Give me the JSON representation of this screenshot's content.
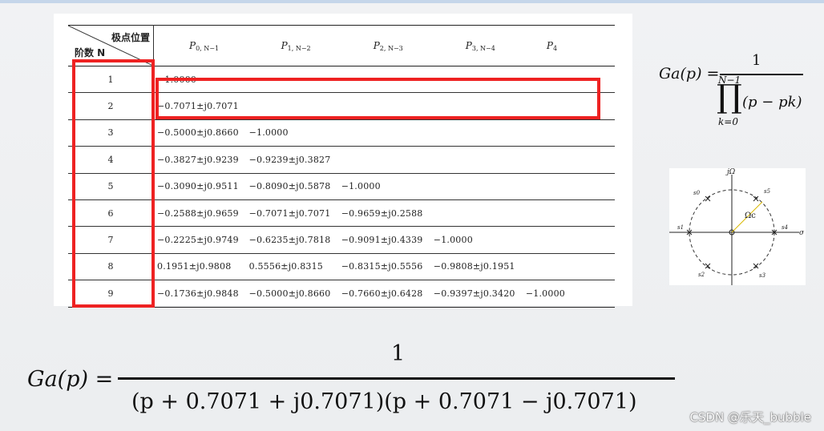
{
  "table": {
    "header_top": "极点位置",
    "header_bottom": "阶数 N",
    "columns": [
      "P0, N−1",
      "P1, N−2",
      "P2, N−3",
      "P3, N−4",
      "P4"
    ],
    "col_main": [
      "P",
      "P",
      "P",
      "P",
      "P"
    ],
    "col_sub": [
      "0, N−1",
      "1, N−2",
      "2, N−3",
      "3, N−4",
      "4"
    ],
    "rows": [
      {
        "n": "1",
        "cells": [
          "−1.0000",
          "",
          "",
          "",
          ""
        ]
      },
      {
        "n": "2",
        "cells": [
          "−0.7071±j0.7071",
          "",
          "",
          "",
          ""
        ]
      },
      {
        "n": "3",
        "cells": [
          "−0.5000±j0.8660",
          "−1.0000",
          "",
          "",
          ""
        ]
      },
      {
        "n": "4",
        "cells": [
          "−0.3827±j0.9239",
          "−0.9239±j0.3827",
          "",
          "",
          ""
        ]
      },
      {
        "n": "5",
        "cells": [
          "−0.3090±j0.9511",
          "−0.8090±j0.5878",
          "−1.0000",
          "",
          ""
        ]
      },
      {
        "n": "6",
        "cells": [
          "−0.2588±j0.9659",
          "−0.7071±j0.7071",
          "−0.9659±j0.2588",
          "",
          ""
        ]
      },
      {
        "n": "7",
        "cells": [
          "−0.2225±j0.9749",
          "−0.6235±j0.7818",
          "−0.9091±j0.4339",
          "−1.0000",
          ""
        ]
      },
      {
        "n": "8",
        "cells": [
          "0.1951±j0.9808",
          "0.5556±j0.8315",
          "−0.8315±j0.5556",
          "−0.9808±j0.1951",
          ""
        ]
      },
      {
        "n": "9",
        "cells": [
          "−0.1736±j0.9848",
          "−0.5000±j0.8660",
          "−0.7660±j0.6428",
          "−0.9397±j0.3420",
          "−1.0000"
        ]
      }
    ]
  },
  "formula_general": {
    "lhs": "Ga(p) =",
    "numerator": "1",
    "upper_limit": "N−1",
    "product": "∏",
    "term": "(p − pk)",
    "lower_limit": "k=0"
  },
  "diagram": {
    "axis_imag": "jΩ",
    "axis_real": "σ",
    "labels": [
      "s0",
      "s5",
      "s1",
      "s4",
      "s2",
      "s3",
      "Ωc"
    ]
  },
  "formula_n2": {
    "lhs": "Ga(p) =",
    "numerator": "1",
    "denominator": "(p + 0.7071 + j0.7071)(p + 0.7071 − j0.7071)"
  },
  "watermark": "CSDN @乐天_bubble",
  "colors": {
    "highlight": "#ee2222"
  }
}
